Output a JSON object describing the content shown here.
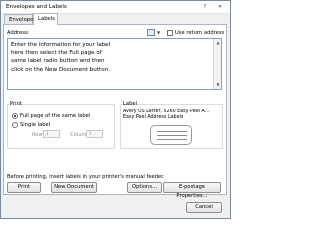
{
  "window": {
    "title": "Envelopes and Labels",
    "help_glyph": "?",
    "close_glyph": "✕"
  },
  "tabs": [
    {
      "label": "Envelopes"
    },
    {
      "label": "Labels"
    }
  ],
  "address": {
    "label": "Address:",
    "text": "Enter the information for your label\nhere then select the Full page of\nsame label radio button and then\nclick on the New Document button.",
    "use_return_address": "Use return address",
    "use_return_address_checked": false
  },
  "print": {
    "label": "Print",
    "full_page": "Full page of the same label",
    "single_label": "Single label",
    "selected": "full_page",
    "row_label": "Row:",
    "row_value": "1",
    "column_label": "Column:",
    "column_value": "1"
  },
  "label": {
    "title": "Label",
    "line1": "Avery US Letter, 5260 Easy Peel A...",
    "line2": "Easy Peel Address Labels"
  },
  "note": "Before printing, insert labels in your printer's manual feeder.",
  "buttons": {
    "print": "Print",
    "new_document": "New Document",
    "options": "Options...",
    "epostage": "E-postage Properties...",
    "cancel": "Cancel"
  }
}
